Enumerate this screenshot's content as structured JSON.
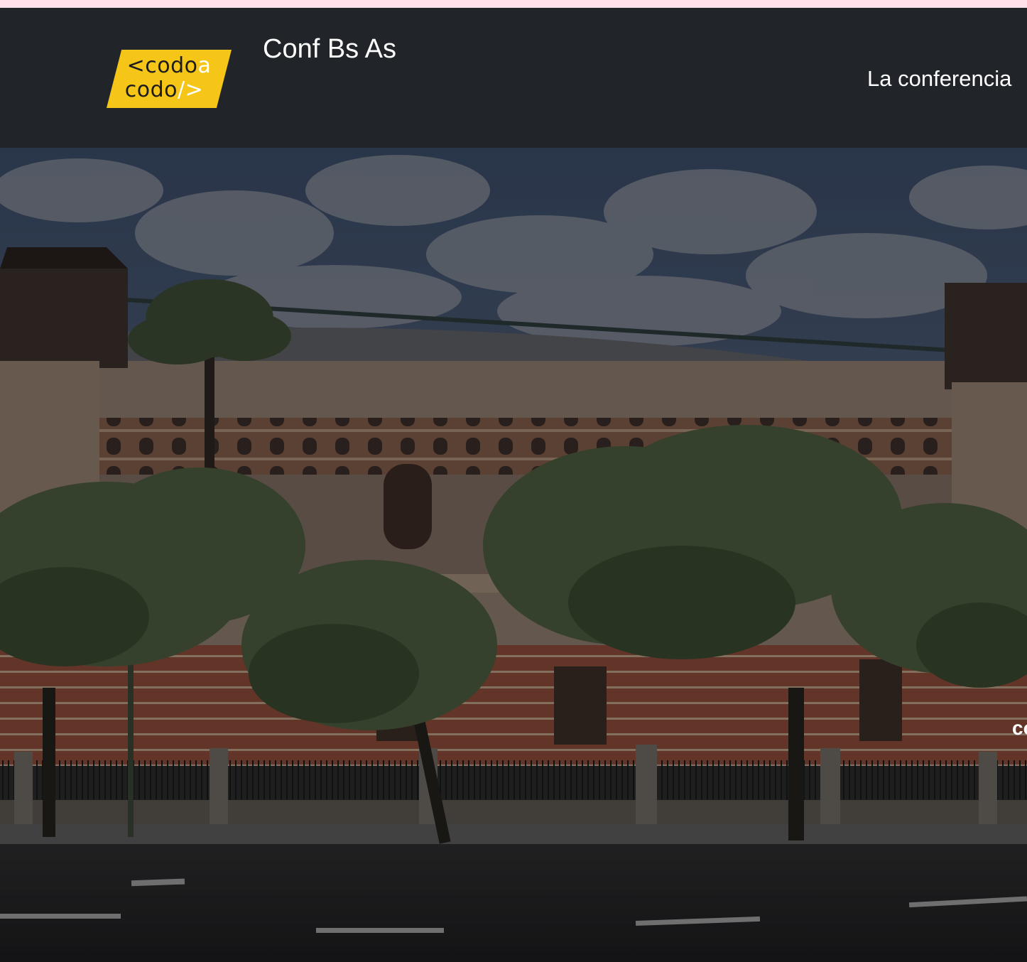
{
  "topbar": {
    "color": "#fde2ea"
  },
  "navbar": {
    "background": "#212529",
    "logo": {
      "line1": {
        "pre": "<codo",
        "post": "a"
      },
      "line2": {
        "pre": "codo",
        "post": "/>"
      },
      "color": "#f5c518"
    },
    "brand_title": "Conf Bs As",
    "links": [
      {
        "label": "La conferencia"
      }
    ]
  },
  "hero": {
    "image": "palacio-de-aguas-corrientes",
    "overlay_text_partial": "co"
  }
}
